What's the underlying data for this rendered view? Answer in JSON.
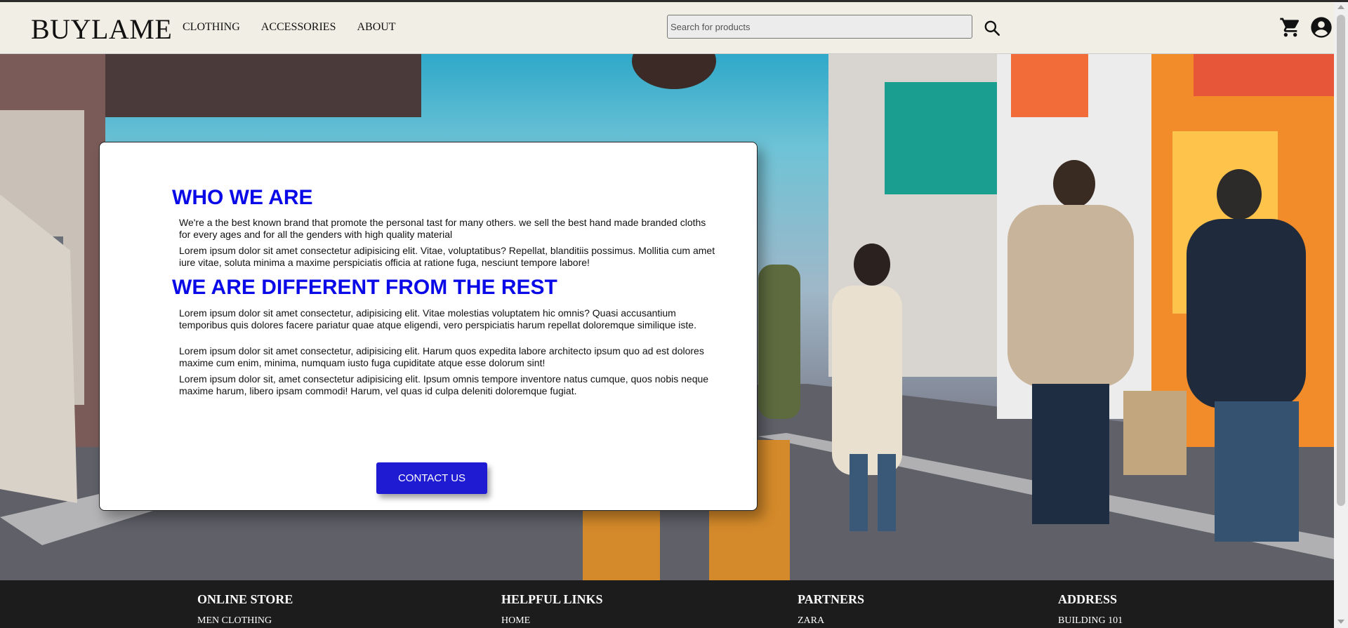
{
  "brand": {
    "logo": "BUYLAME"
  },
  "nav": {
    "items": [
      "CLOTHING",
      "ACCESSORIES",
      "ABOUT"
    ]
  },
  "search": {
    "placeholder": "Search for products",
    "value": ""
  },
  "icons": {
    "search": "search-icon",
    "cart": "cart-icon",
    "account": "account-icon"
  },
  "colors": {
    "accent": "#0a0ae8",
    "button": "#1f1bd2",
    "header_bg": "#f1efe5",
    "footer_bg": "#1c1c1c"
  },
  "about": {
    "heading1": "WHO WE ARE",
    "p1": "We're a the best known brand that promote the personal tast for many others. we sell the best hand made branded cloths for every ages and for all the genders with high quality material",
    "p2": "Lorem ipsum dolor sit amet consectetur adipisicing elit. Vitae, voluptatibus? Repellat, blanditiis possimus. Mollitia cum amet iure vitae, soluta minima a maxime perspiciatis officia at ratione fuga, nesciunt tempore labore!",
    "heading2": "WE ARE DIFFERENT FROM THE REST",
    "p3": "Lorem ipsum dolor sit amet consectetur, adipisicing elit. Vitae molestias voluptatem hic omnis? Quasi accusantium temporibus quis dolores facere pariatur quae atque eligendi, vero perspiciatis harum repellat doloremque similique iste.",
    "p4": "Lorem ipsum dolor sit amet consectetur, adipisicing elit. Harum quos expedita labore architecto ipsum quo ad est dolores maxime cum enim, minima, numquam iusto fuga cupiditate atque esse dolorum sint!",
    "p5": "Lorem ipsum dolor sit, amet consectetur adipisicing elit. Ipsum omnis tempore inventore natus cumque, quos nobis neque maxime harum, libero ipsam commodi! Harum, vel quas id culpa deleniti doloremque fugiat.",
    "cta": "CONTACT US"
  },
  "footer": {
    "columns": [
      {
        "title": "ONLINE STORE",
        "first_link": "MEN CLOTHING"
      },
      {
        "title": "HELPFUL LINKS",
        "first_link": "HOME"
      },
      {
        "title": "PARTNERS",
        "first_link": "ZARA"
      },
      {
        "title": "ADDRESS",
        "first_link": "BUILDING 101"
      }
    ]
  }
}
